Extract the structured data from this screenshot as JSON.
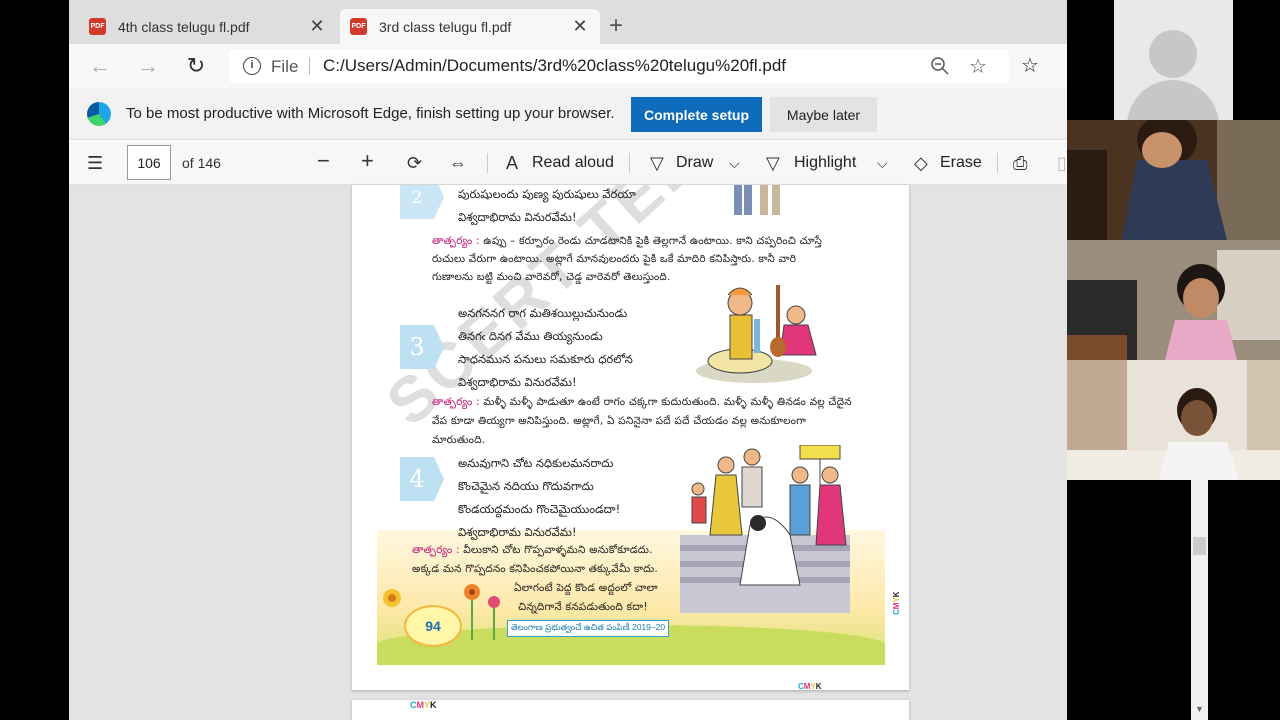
{
  "browser": {
    "tabs": [
      {
        "label": "4th class telugu fl.pdf",
        "icon": "pdf-icon",
        "active": false
      },
      {
        "label": "3rd class telugu fl.pdf",
        "icon": "pdf-icon",
        "active": true
      }
    ],
    "address": {
      "scheme_label": "File",
      "url": "C:/Users/Admin/Documents/3rd%20class%20telugu%20fl.pdf"
    },
    "banner": {
      "text": "To be most productive with Microsoft Edge, finish setting up your browser.",
      "primary_button": "Complete setup",
      "secondary_button": "Maybe later"
    },
    "pdf_toolbar": {
      "page_current": "106",
      "page_total_label": "of 146",
      "read_aloud": "Read aloud",
      "draw": "Draw",
      "highlight": "Highlight",
      "erase": "Erase"
    }
  },
  "pdf_page": {
    "verse2_lines": [
      "పురుషులందు పుణ్య పురుషులు వేరయా",
      "విశ్వదాభిరామ వినురవేమ!"
    ],
    "meaning_label": "తాత్పర్యం :",
    "meaning2_lines": [
      "ఉప్పు – కర్పూరం రెండు చూడటానికి పైకి తెల్లగానే ఉంటాయి. కాని చప్పరించి చూస్తే",
      "రుచులు వేరుగా ఉంటాయి. అట్లాగే మానవులందరు పైకి ఒకే మాదిరి కనిపిస్తారు. కానీ వారి",
      "గుణాలను బట్టి మంచి వారెవరో, చెడ్డ వారెవరో తెలుస్తుంది."
    ],
    "verse3_num": "3",
    "verse3_lines": [
      "అనగననగ రాగ మతిశయిల్లుచునుండు",
      "తినగఁ దినగ వేము తియ్యనుండు",
      "సాధనమున పనులు సమకూరు ధరలోన",
      "విశ్వదాభిరామ వినురవేమ!"
    ],
    "meaning3_lines": [
      "మళ్ళీ మళ్ళీ పాడుతూ ఉంటే రాగం చక్కగా కుదురుతుంది. మళ్ళీ మళ్ళీ తినడం వల్ల చేదైన",
      "వేప కూడా తియ్యగా అనిపిస్తుంది. అట్లాగే, ఏ పనినైనా పదే పదే చేయడం వల్ల అనుకూలంగా",
      "మారుతుంది."
    ],
    "verse4_num": "4",
    "verse4_lines": [
      "అనువుగాని చోట నధికులమనరాదు",
      "కొంచెమైన నదియు గొదువగాదు",
      "కొండయద్దమందు గొంచెమైయుండదా!",
      "విశ్వదాభిరామ వినురవేమ!"
    ],
    "meaning4_lines": [
      "వీలుకాని చోట గొప్పవాళ్ళమని అనుకోకూడదు.",
      "అక్కడ మన గొప్పదనం కనిపించకపోయినా తక్కువేమీ కాదు.",
      "ఏలాగంటే పెద్ద కొండ అద్దంలో చాలా",
      "చిన్నదిగానే కనపడుతుంది కదా!"
    ],
    "page_number": "94",
    "footer": "తెలంగాణ ప్రభుత్వంచే ఉచిత పంపిణీ 2019–20",
    "cmyk": "CMYK"
  },
  "colors": {
    "accent": "#0f6cbd",
    "meaning_label": "#c2187a",
    "verse_number_bg": "#bde1f3"
  }
}
